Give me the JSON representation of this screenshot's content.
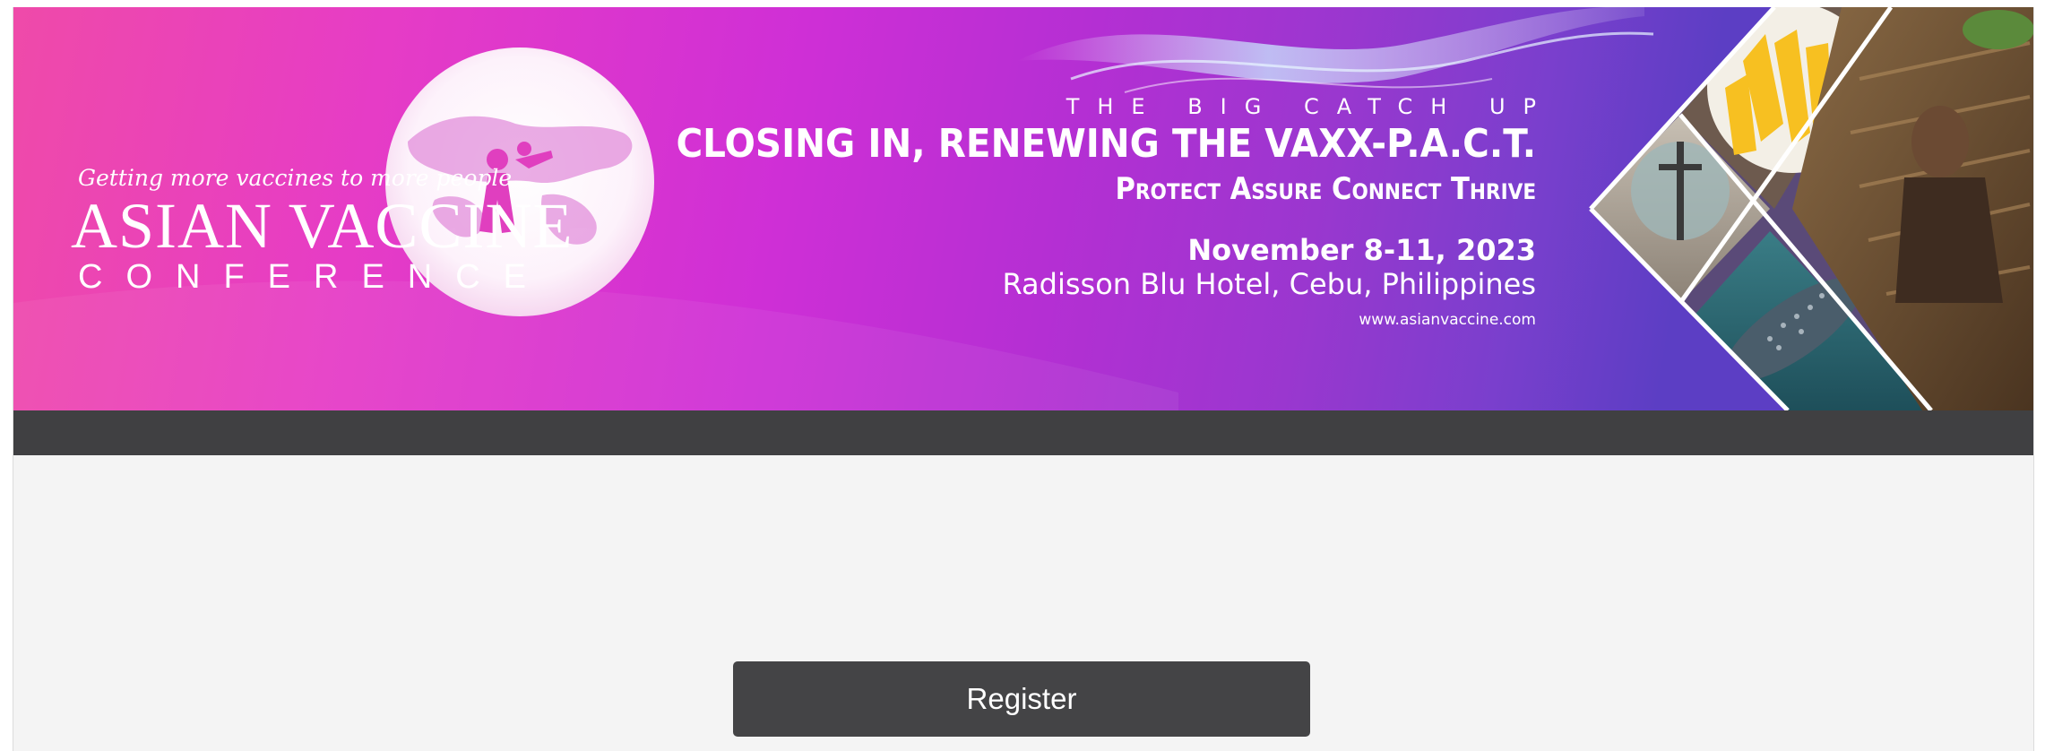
{
  "banner": {
    "logo": {
      "tagline": "Getting more vaccines to more people",
      "name": "ASIAN VACCINE",
      "subtitle": "CONFERENCE"
    },
    "kicker": "THE BIG CATCH UP",
    "headline": "CLOSING IN, RENEWING THE VAXX-P.A.C.T.",
    "pillars": "Protect Assure Connect Thrive",
    "date": "November 8-11, 2023",
    "venue": "Radisson Blu Hotel, Cebu, Philippines",
    "website": "www.asianvaccine.com",
    "colors": {
      "gradient_start": "#ef4aa9",
      "gradient_mid": "#cf2fd6",
      "gradient_end": "#5c3ec4"
    }
  },
  "nav": {
    "color": "#404042"
  },
  "actions": {
    "register_label": "Register"
  }
}
